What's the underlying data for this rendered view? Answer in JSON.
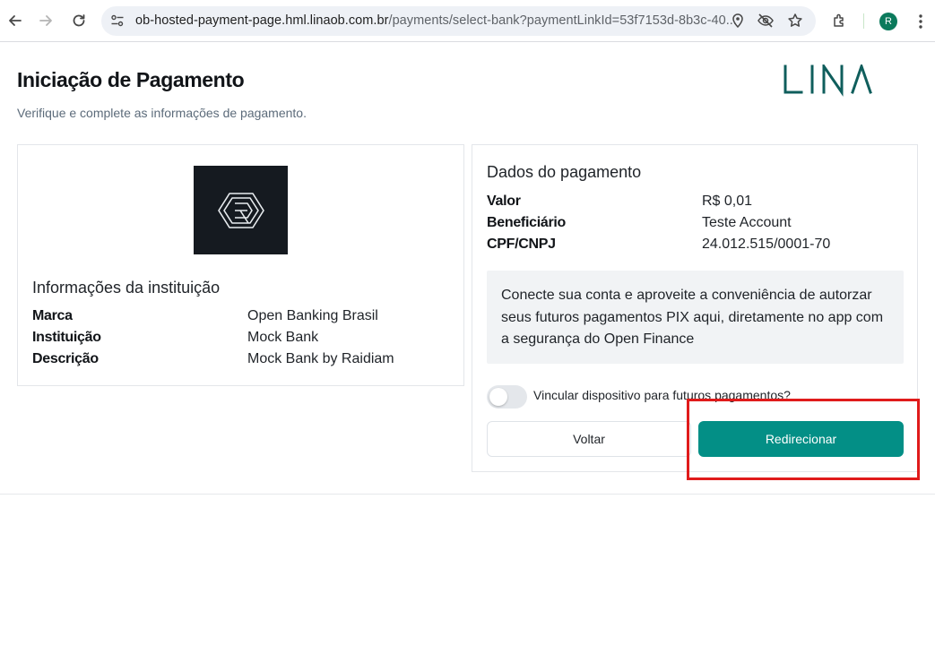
{
  "browser": {
    "url_domain": "ob-hosted-payment-page.hml.linaob.com.br",
    "url_path": "/payments/select-bank?paymentLinkId=53f7153d-8b3c-40...",
    "profile_initial": "R"
  },
  "header": {
    "title": "Iniciação de Pagamento",
    "subtitle": "Verifique e complete as informações de pagamento.",
    "logo_text": "LINA",
    "logo_color": "#0f5e5c"
  },
  "institution": {
    "section_title": "Informações da instituição",
    "rows": [
      {
        "label": "Marca",
        "value": "Open Banking Brasil"
      },
      {
        "label": "Instituição",
        "value": "Mock Bank"
      },
      {
        "label": "Descrição",
        "value": "Mock Bank by Raidiam"
      }
    ]
  },
  "payment": {
    "section_title": "Dados do pagamento",
    "rows": [
      {
        "label": "Valor",
        "value": "R$ 0,01"
      },
      {
        "label": "Beneficiário",
        "value": "Teste Account"
      },
      {
        "label": "CPF/CNPJ",
        "value": "24.012.515/0001-70"
      }
    ],
    "notice": "Conecte sua conta e aproveite a conveniência de autorzar seus futuros pagamentos PIX aqui, diretamente no app com a segurança do Open Finance",
    "toggle_label": "Vincular dispositivo para futuros pagamentos?",
    "toggle_on": false,
    "back_label": "Voltar",
    "redirect_label": "Redirecionar",
    "accent_color": "#038f86"
  }
}
